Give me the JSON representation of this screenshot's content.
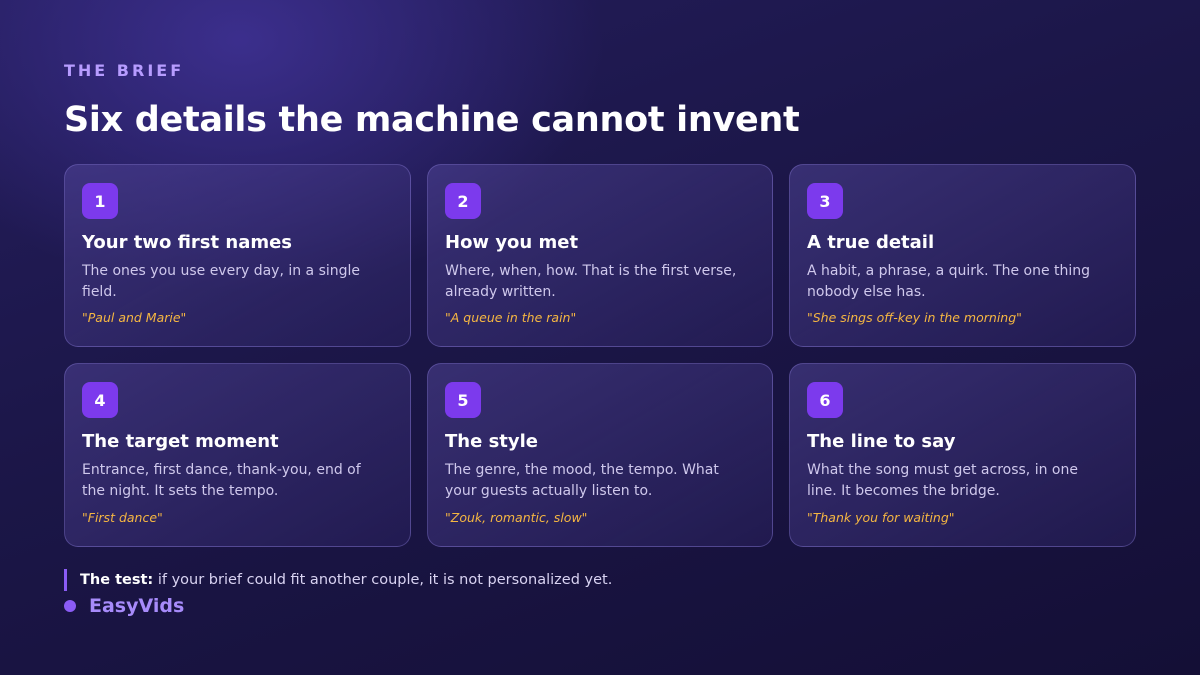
{
  "header": {
    "eyebrow": "THE BRIEF",
    "title": "Six details the machine cannot invent"
  },
  "cards": [
    {
      "number": "1",
      "title": "Your two first names",
      "description": "The ones you use every day, in a single field.",
      "example": "\"Paul and Marie\""
    },
    {
      "number": "2",
      "title": "How you met",
      "description": "Where, when, how. That is the first verse, already written.",
      "example": "\"A queue in the rain\""
    },
    {
      "number": "3",
      "title": "A true detail",
      "description": "A habit, a phrase, a quirk. The one thing nobody else has.",
      "example": "\"She sings off-key in the morning\""
    },
    {
      "number": "4",
      "title": "The target moment",
      "description": "Entrance, first dance, thank-you, end of the night. It sets the tempo.",
      "example": "\"First dance\""
    },
    {
      "number": "5",
      "title": "The style",
      "description": "The genre, the mood, the tempo. What your guests actually listen to.",
      "example": "\"Zouk, romantic, slow\""
    },
    {
      "number": "6",
      "title": "The line to say",
      "description": "What the song must get across, in one line. It becomes the bridge.",
      "example": "\"Thank you for waiting\""
    }
  ],
  "footer": {
    "note_label": "The test:",
    "note_text": " if your brief could fit another couple, it is not personalized yet.",
    "brand": "EasyVids"
  },
  "colors": {
    "accent": "#7c3aed",
    "eyebrow": "#b79cff",
    "example": "#f5b642",
    "brand": "#a78bfa"
  }
}
